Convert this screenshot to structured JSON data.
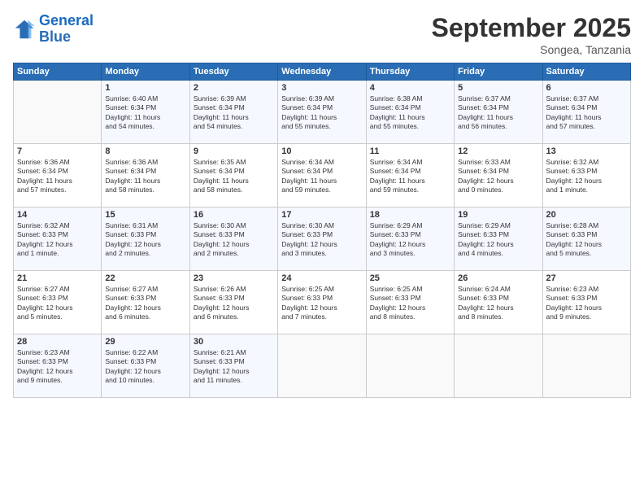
{
  "app": {
    "logo_line1": "General",
    "logo_line2": "Blue"
  },
  "header": {
    "month_title": "September 2025",
    "location": "Songea, Tanzania"
  },
  "days_of_week": [
    "Sunday",
    "Monday",
    "Tuesday",
    "Wednesday",
    "Thursday",
    "Friday",
    "Saturday"
  ],
  "weeks": [
    [
      {
        "day": "",
        "info": ""
      },
      {
        "day": "1",
        "info": "Sunrise: 6:40 AM\nSunset: 6:34 PM\nDaylight: 11 hours\nand 54 minutes."
      },
      {
        "day": "2",
        "info": "Sunrise: 6:39 AM\nSunset: 6:34 PM\nDaylight: 11 hours\nand 54 minutes."
      },
      {
        "day": "3",
        "info": "Sunrise: 6:39 AM\nSunset: 6:34 PM\nDaylight: 11 hours\nand 55 minutes."
      },
      {
        "day": "4",
        "info": "Sunrise: 6:38 AM\nSunset: 6:34 PM\nDaylight: 11 hours\nand 55 minutes."
      },
      {
        "day": "5",
        "info": "Sunrise: 6:37 AM\nSunset: 6:34 PM\nDaylight: 11 hours\nand 56 minutes."
      },
      {
        "day": "6",
        "info": "Sunrise: 6:37 AM\nSunset: 6:34 PM\nDaylight: 11 hours\nand 57 minutes."
      }
    ],
    [
      {
        "day": "7",
        "info": "Sunrise: 6:36 AM\nSunset: 6:34 PM\nDaylight: 11 hours\nand 57 minutes."
      },
      {
        "day": "8",
        "info": "Sunrise: 6:36 AM\nSunset: 6:34 PM\nDaylight: 11 hours\nand 58 minutes."
      },
      {
        "day": "9",
        "info": "Sunrise: 6:35 AM\nSunset: 6:34 PM\nDaylight: 11 hours\nand 58 minutes."
      },
      {
        "day": "10",
        "info": "Sunrise: 6:34 AM\nSunset: 6:34 PM\nDaylight: 11 hours\nand 59 minutes."
      },
      {
        "day": "11",
        "info": "Sunrise: 6:34 AM\nSunset: 6:34 PM\nDaylight: 11 hours\nand 59 minutes."
      },
      {
        "day": "12",
        "info": "Sunrise: 6:33 AM\nSunset: 6:34 PM\nDaylight: 12 hours\nand 0 minutes."
      },
      {
        "day": "13",
        "info": "Sunrise: 6:32 AM\nSunset: 6:33 PM\nDaylight: 12 hours\nand 1 minute."
      }
    ],
    [
      {
        "day": "14",
        "info": "Sunrise: 6:32 AM\nSunset: 6:33 PM\nDaylight: 12 hours\nand 1 minute."
      },
      {
        "day": "15",
        "info": "Sunrise: 6:31 AM\nSunset: 6:33 PM\nDaylight: 12 hours\nand 2 minutes."
      },
      {
        "day": "16",
        "info": "Sunrise: 6:30 AM\nSunset: 6:33 PM\nDaylight: 12 hours\nand 2 minutes."
      },
      {
        "day": "17",
        "info": "Sunrise: 6:30 AM\nSunset: 6:33 PM\nDaylight: 12 hours\nand 3 minutes."
      },
      {
        "day": "18",
        "info": "Sunrise: 6:29 AM\nSunset: 6:33 PM\nDaylight: 12 hours\nand 3 minutes."
      },
      {
        "day": "19",
        "info": "Sunrise: 6:29 AM\nSunset: 6:33 PM\nDaylight: 12 hours\nand 4 minutes."
      },
      {
        "day": "20",
        "info": "Sunrise: 6:28 AM\nSunset: 6:33 PM\nDaylight: 12 hours\nand 5 minutes."
      }
    ],
    [
      {
        "day": "21",
        "info": "Sunrise: 6:27 AM\nSunset: 6:33 PM\nDaylight: 12 hours\nand 5 minutes."
      },
      {
        "day": "22",
        "info": "Sunrise: 6:27 AM\nSunset: 6:33 PM\nDaylight: 12 hours\nand 6 minutes."
      },
      {
        "day": "23",
        "info": "Sunrise: 6:26 AM\nSunset: 6:33 PM\nDaylight: 12 hours\nand 6 minutes."
      },
      {
        "day": "24",
        "info": "Sunrise: 6:25 AM\nSunset: 6:33 PM\nDaylight: 12 hours\nand 7 minutes."
      },
      {
        "day": "25",
        "info": "Sunrise: 6:25 AM\nSunset: 6:33 PM\nDaylight: 12 hours\nand 8 minutes."
      },
      {
        "day": "26",
        "info": "Sunrise: 6:24 AM\nSunset: 6:33 PM\nDaylight: 12 hours\nand 8 minutes."
      },
      {
        "day": "27",
        "info": "Sunrise: 6:23 AM\nSunset: 6:33 PM\nDaylight: 12 hours\nand 9 minutes."
      }
    ],
    [
      {
        "day": "28",
        "info": "Sunrise: 6:23 AM\nSunset: 6:33 PM\nDaylight: 12 hours\nand 9 minutes."
      },
      {
        "day": "29",
        "info": "Sunrise: 6:22 AM\nSunset: 6:33 PM\nDaylight: 12 hours\nand 10 minutes."
      },
      {
        "day": "30",
        "info": "Sunrise: 6:21 AM\nSunset: 6:33 PM\nDaylight: 12 hours\nand 11 minutes."
      },
      {
        "day": "",
        "info": ""
      },
      {
        "day": "",
        "info": ""
      },
      {
        "day": "",
        "info": ""
      },
      {
        "day": "",
        "info": ""
      }
    ]
  ]
}
